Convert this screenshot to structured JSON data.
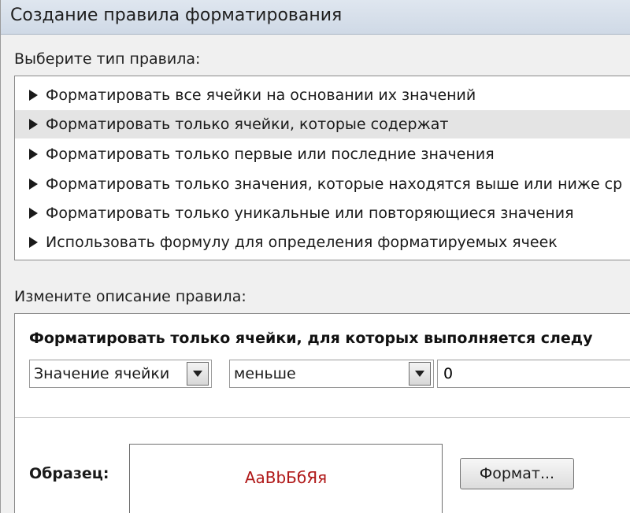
{
  "window": {
    "title": "Создание правила форматирования"
  },
  "rule_type": {
    "label": "Выберите тип правила:",
    "items": [
      {
        "label": "Форматировать все ячейки на основании их значений"
      },
      {
        "label": "Форматировать только ячейки, которые содержат"
      },
      {
        "label": "Форматировать только первые или последние значения"
      },
      {
        "label": "Форматировать только значения, которые находятся выше или ниже ср"
      },
      {
        "label": "Форматировать только уникальные или повторяющиеся значения"
      },
      {
        "label": "Использовать формулу для определения форматируемых ячеек"
      }
    ],
    "selected_index": 1
  },
  "description": {
    "label": "Измените описание правила:",
    "heading": "Форматировать только ячейки, для которых выполняется следу",
    "condition_field": "Значение ячейки",
    "operator": "меньше",
    "value": "0",
    "sample_label": "Образец:",
    "sample_text": "АаBbБбЯя",
    "format_button": "Формат..."
  },
  "colors": {
    "sample_text": "#b01818",
    "selected_row": "#e4e4e4"
  }
}
